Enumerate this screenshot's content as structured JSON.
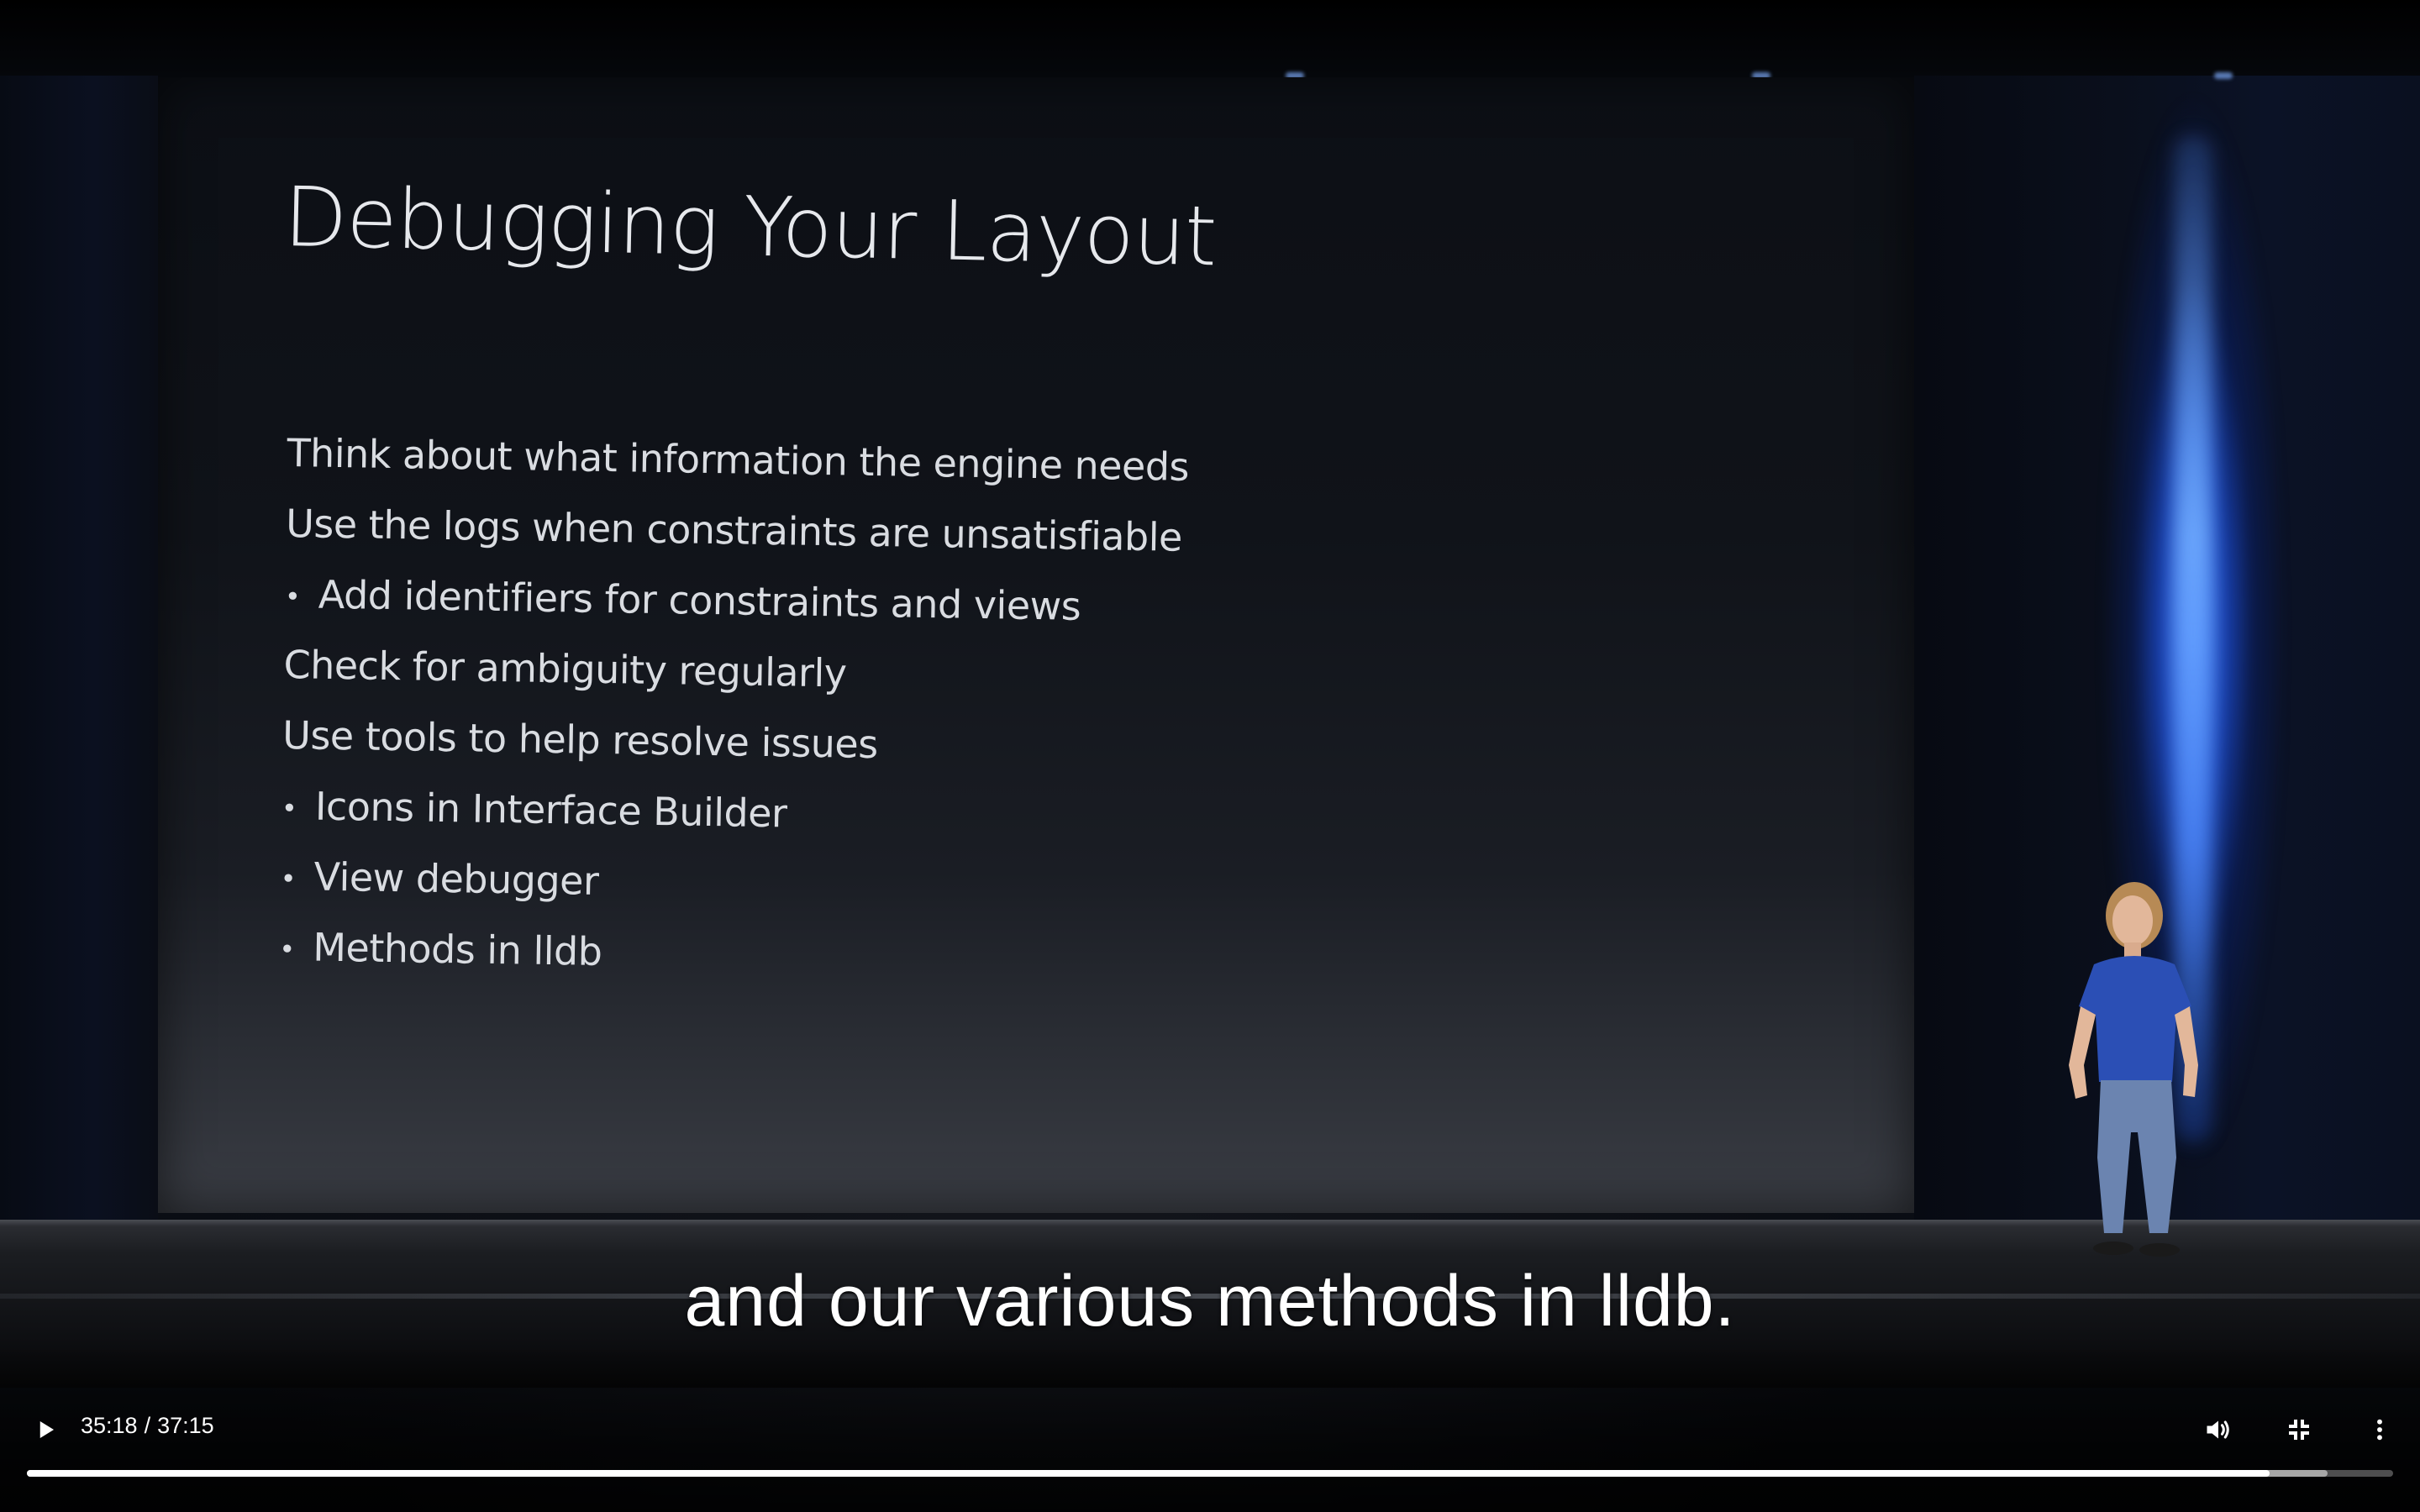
{
  "slide": {
    "title": "Debugging Your Layout",
    "bullets": [
      {
        "text": "Think about what information the engine needs",
        "level": 0
      },
      {
        "text": "Use the logs when constraints are unsatisfiable",
        "level": 0
      },
      {
        "text": "Add identifiers for constraints and views",
        "level": 1
      },
      {
        "text": "Check for ambiguity regularly",
        "level": 0
      },
      {
        "text": "Use tools to help resolve issues",
        "level": 0
      },
      {
        "text": "Icons in Interface Builder",
        "level": 1
      },
      {
        "text": "View debugger",
        "level": 1
      },
      {
        "text": "Methods in lldb",
        "level": 1
      }
    ]
  },
  "caption": {
    "text": "and our various methods in lldb."
  },
  "controls": {
    "current_time": "35:18",
    "separator": "/",
    "duration": "37:15",
    "played_fraction": 0.9477,
    "buffered_fraction": 0.9723,
    "icons": {
      "play": "play-icon",
      "volume": "volume-icon",
      "exit_fullscreen": "exit-fullscreen-icon",
      "more": "more-vertical-icon"
    }
  },
  "colors": {
    "caption": "#ffffff",
    "stage_light": "#3d7bff",
    "progress_played": "#ffffff"
  }
}
